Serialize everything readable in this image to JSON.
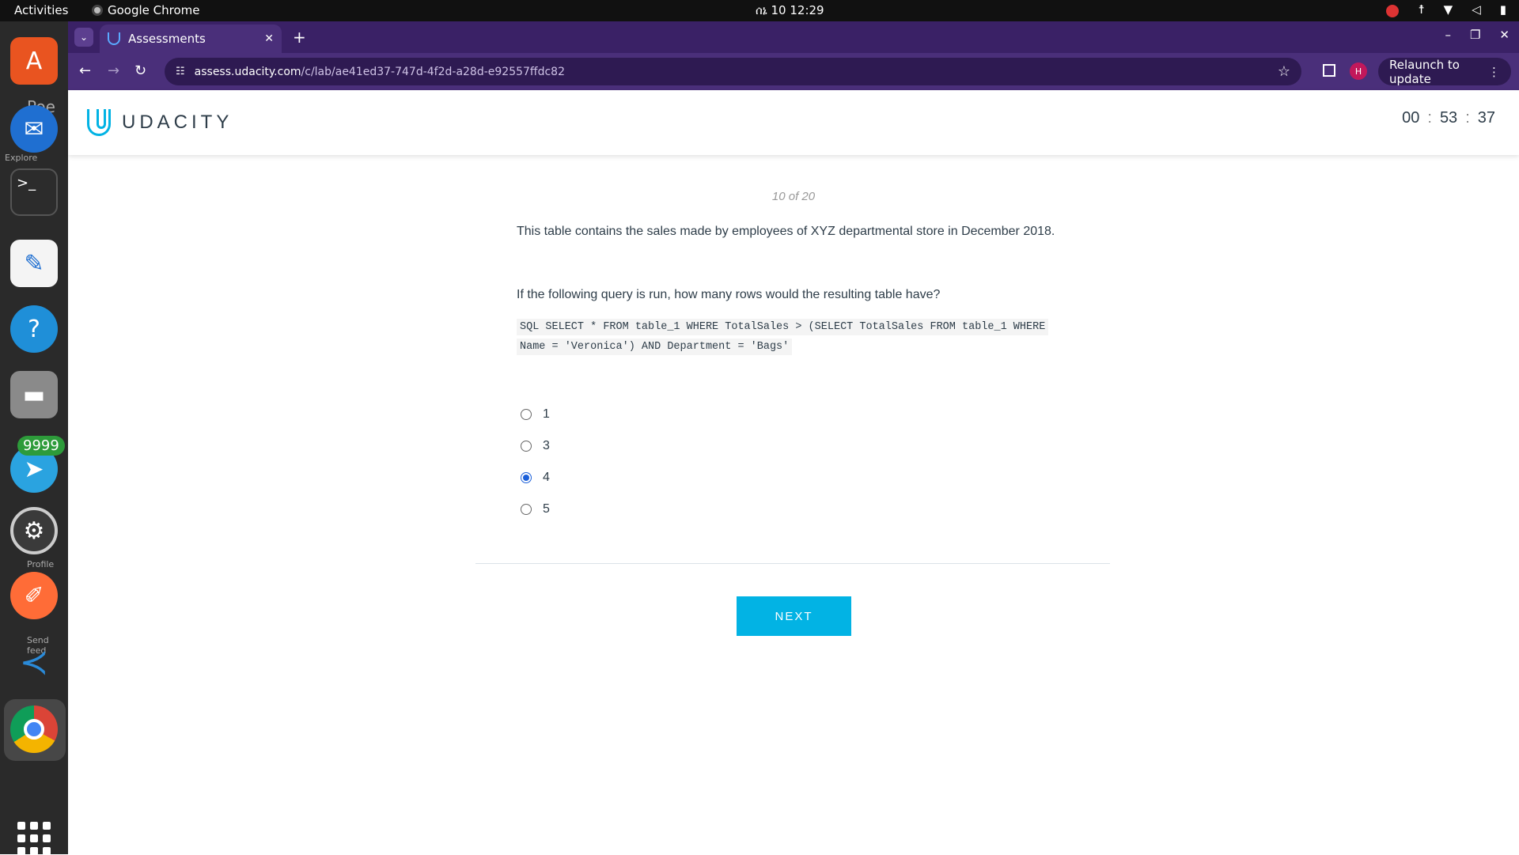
{
  "topbar": {
    "activities": "Activities",
    "app_name": "Google Chrome",
    "clock": "ሰኔ 10  12:29"
  },
  "dock": {
    "badge": "9999",
    "ghost_labels": [
      "Poe",
      "Explore",
      "Profile",
      "Send feed"
    ],
    "icons": [
      "ubuntu-software-icon",
      "thunderbird-icon",
      "terminal-icon",
      "text-editor-icon",
      "help-icon",
      "files-icon",
      "telegram-icon",
      "settings-icon",
      "postman-icon",
      "vscode-icon",
      "chrome-icon",
      "app-grid-icon"
    ]
  },
  "browser": {
    "tab_title": "Assessments",
    "url_host": "assess.udacity.com",
    "url_path": "/c/lab/ae41ed37-747d-4f2d-a28d-e92557ffdc82",
    "profile_initial": "H",
    "relaunch_label": "Relaunch to update"
  },
  "page": {
    "logo_text": "UDACITY",
    "timer": {
      "hours": "00",
      "minutes": "53",
      "seconds": "37"
    },
    "counter": "10 of 20",
    "intro": "This table contains the sales made by employees of XYZ departmental store in December 2018.",
    "question": "If the following query is run, how many rows would the resulting table have?",
    "code_line1": "SQL SELECT * FROM table_1 WHERE TotalSales > (SELECT TotalSales FROM table_1 WHERE",
    "code_line2": "Name = 'Veronica') AND Department = 'Bags'",
    "options": [
      {
        "label": "1",
        "selected": false
      },
      {
        "label": "3",
        "selected": false
      },
      {
        "label": "4",
        "selected": true
      },
      {
        "label": "5",
        "selected": false
      }
    ],
    "next_label": "NEXT"
  },
  "colors": {
    "accent": "#02b3e4",
    "chrome_frame": "#4a2f7a",
    "radio_selected": "#1a5fd9"
  }
}
